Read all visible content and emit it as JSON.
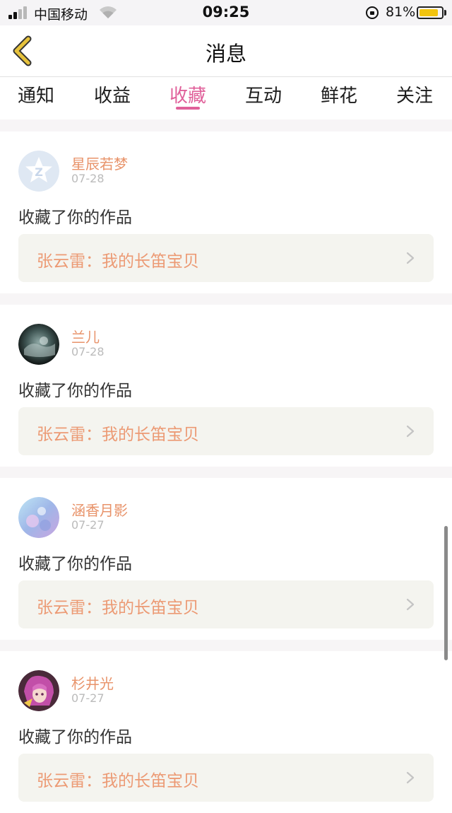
{
  "status_bar": {
    "carrier": "中国移动",
    "time": "09:25",
    "battery_percent": "81%",
    "battery_level": 0.81,
    "icons": [
      "signal-icon",
      "wifi-icon",
      "orientation-lock-icon",
      "battery-icon"
    ]
  },
  "header": {
    "title": "消息",
    "back_icon": "chevron-left-icon"
  },
  "tabs": [
    {
      "label": "通知",
      "active": false
    },
    {
      "label": "收益",
      "active": false
    },
    {
      "label": "收藏",
      "active": true
    },
    {
      "label": "互动",
      "active": false
    },
    {
      "label": "鲜花",
      "active": false
    },
    {
      "label": "关注",
      "active": false
    }
  ],
  "messages": [
    {
      "user": "星辰若梦",
      "date": "07-28",
      "action": "收藏了你的作品",
      "work": "张云雷：我的长笛宝贝"
    },
    {
      "user": "兰儿",
      "date": "07-28",
      "action": "收藏了你的作品",
      "work": "张云雷：我的长笛宝贝"
    },
    {
      "user": "涵香月影",
      "date": "07-27",
      "action": "收藏了你的作品",
      "work": "张云雷：我的长笛宝贝"
    },
    {
      "user": "杉井光",
      "date": "07-27",
      "action": "收藏了你的作品",
      "work": "张云雷：我的长笛宝贝"
    }
  ],
  "colors": {
    "accent": "#e0609a",
    "username": "#e8936a",
    "work_title": "#ec9a74",
    "back_arrow": "#e6c23c"
  }
}
